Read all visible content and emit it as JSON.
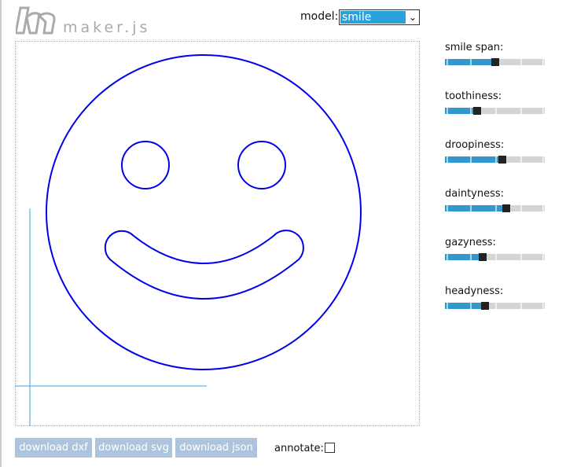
{
  "header": {
    "logo_text": "maker.js",
    "model_label": "model:",
    "model_value": "smile"
  },
  "params": [
    {
      "label": "smile span:",
      "value": 0.5
    },
    {
      "label": "toothiness:",
      "value": 0.31
    },
    {
      "label": "droopiness:",
      "value": 0.58
    },
    {
      "label": "daintyness:",
      "value": 0.62
    },
    {
      "label": "gazyness:",
      "value": 0.37
    },
    {
      "label": "headyness:",
      "value": 0.39
    }
  ],
  "footer": {
    "download_dxf": "download dxf",
    "download_svg": "download svg",
    "download_json": "download json",
    "annotate_label": "annotate:",
    "annotate_checked": false
  },
  "colors": {
    "path": "#0000ee",
    "axis": "#3aa0e0",
    "slider_fill": "#3498cc",
    "button": "#aec4de"
  }
}
